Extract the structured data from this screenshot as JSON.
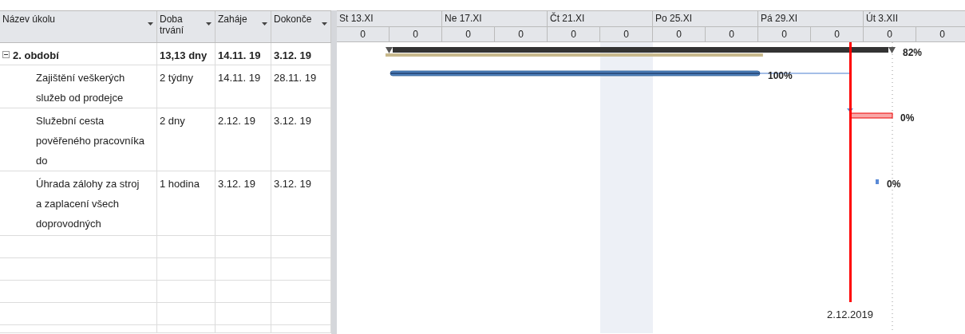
{
  "columns": [
    {
      "label": "Název úkolu"
    },
    {
      "label": "Doba trvání"
    },
    {
      "label": "Zaháje"
    },
    {
      "label": "Dokonče"
    }
  ],
  "tasks": [
    {
      "kind": "summary",
      "expanded": true,
      "name": "2. období",
      "duration": "13,13 dny",
      "start": "14.11. 19",
      "finish": "3.12. 19",
      "level": 0.74,
      "bar_label": "82%"
    },
    {
      "kind": "task",
      "name": "Zajištění veškerých služeb od prodejce",
      "duration": "2 týdny",
      "start": "14.11. 19",
      "finish": "28.11. 19",
      "level": 1,
      "bar_label": "100%"
    },
    {
      "kind": "task",
      "name": "Služební cesta pověřeného pracovníka do",
      "duration": "2 dny",
      "start": "2.12. 19",
      "finish": "3.12. 19",
      "bar_label": "0%"
    },
    {
      "kind": "task",
      "name": "Úhrada zálohy za stroj a zaplacení všech doprovodných",
      "duration": "1 hodina",
      "start": "3.12. 19",
      "finish": "3.12. 19",
      "bar_label": "0%"
    }
  ],
  "timescale": {
    "major": [
      "St 13.XI",
      "Ne 17.XI",
      "Čt 21.XI",
      "Po 25.XI",
      "Pá 29.XI",
      "Út 3.XII"
    ],
    "minor": [
      "0",
      "0",
      "0",
      "0",
      "0",
      "0",
      "0",
      "0",
      "0",
      "0",
      "0",
      "0"
    ]
  },
  "status_line": {
    "label": "2.12.2019"
  }
}
